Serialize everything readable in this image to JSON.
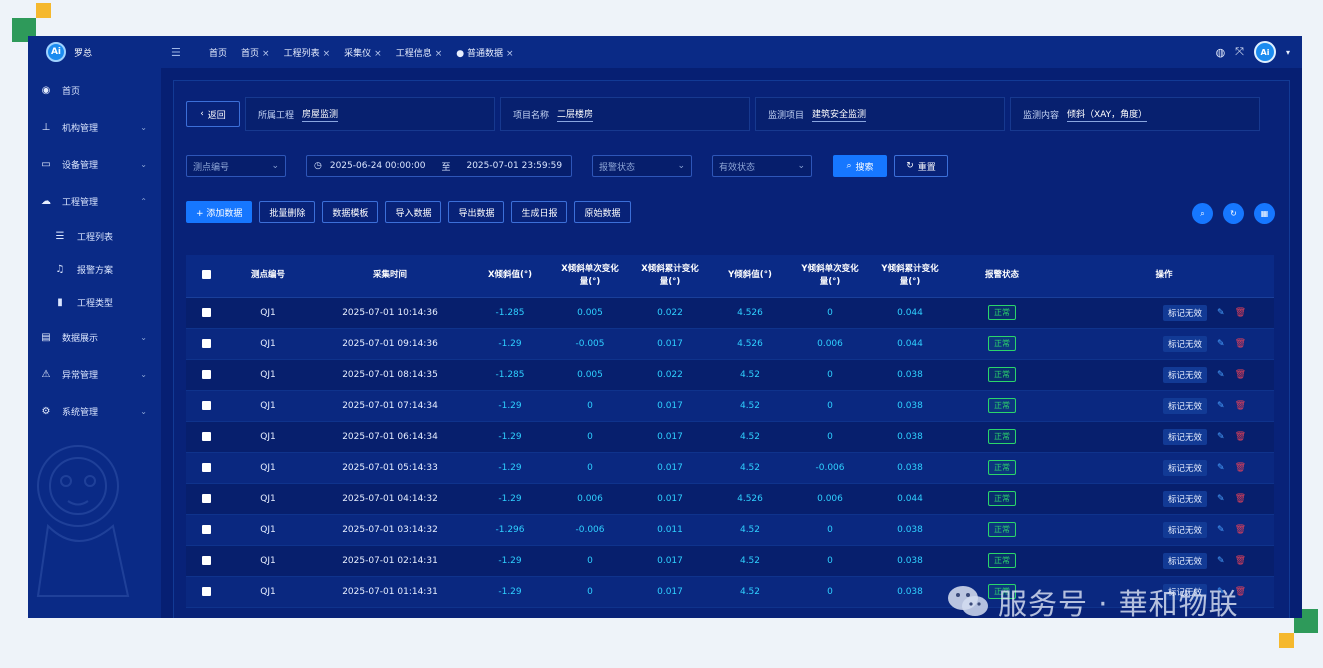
{
  "app": {
    "brand_name": "罗总",
    "avatar_text": "Ai"
  },
  "sidebar": {
    "items": [
      {
        "label": "首页",
        "icon": "dashboard-icon",
        "chevron": ""
      },
      {
        "label": "机构管理",
        "icon": "org-icon",
        "chevron": "⌄"
      },
      {
        "label": "设备管理",
        "icon": "monitor-icon",
        "chevron": "⌄"
      },
      {
        "label": "工程管理",
        "icon": "cloud-icon",
        "chevron": "⌃"
      }
    ],
    "sub_items": [
      {
        "label": "工程列表",
        "icon": "list-icon"
      },
      {
        "label": "报警方案",
        "icon": "alarm-icon"
      },
      {
        "label": "工程类型",
        "icon": "bar-icon"
      }
    ],
    "items_after": [
      {
        "label": "数据展示",
        "icon": "display-icon",
        "chevron": "⌄"
      },
      {
        "label": "异常管理",
        "icon": "warning-icon",
        "chevron": "⌄"
      },
      {
        "label": "系统管理",
        "icon": "gear-icon",
        "chevron": "⌄"
      }
    ]
  },
  "topbar": {
    "tabs": [
      {
        "label": "首页",
        "closable": ""
      },
      {
        "label": "首页",
        "closable": "×"
      },
      {
        "label": "工程列表",
        "closable": "×"
      },
      {
        "label": "采集仪",
        "closable": "×"
      },
      {
        "label": "工程信息",
        "closable": "×"
      },
      {
        "label": "● 普通数据",
        "closable": "×"
      }
    ]
  },
  "info": {
    "back_label": "返回",
    "project_key": "所属工程",
    "project_val": "房屋监测",
    "name_key": "项目名称",
    "name_val": "二层楼房",
    "item_key": "监测项目",
    "item_val": "建筑安全监测",
    "content_key": "监测内容",
    "content_val": "倾斜（XAY，角度）"
  },
  "filters": {
    "point_placeholder": "测点编号",
    "start_date": "2025-06-24 00:00:00",
    "to": "至",
    "end_date": "2025-07-01 23:59:59",
    "alarm_placeholder": "报警状态",
    "valid_placeholder": "有效状态",
    "search_label": "搜索",
    "reset_label": "重置"
  },
  "actions": {
    "add": "+ 添加数据",
    "batch_delete": "批量删除",
    "template": "数据模板",
    "import": "导入数据",
    "export": "导出数据",
    "report": "生成日报",
    "raw": "原始数据"
  },
  "table": {
    "headers": {
      "point": "测点编号",
      "time": "采集时间",
      "x_tilt": "X倾斜值(°)",
      "x_single_1": "X倾斜单次变化",
      "x_single_2": "量(°)",
      "x_total_1": "X倾斜累计变化",
      "x_total_2": "量(°)",
      "y_tilt": "Y倾斜值(°)",
      "y_single_1": "Y倾斜单次变化",
      "y_single_2": "量(°)",
      "y_total_1": "Y倾斜累计变化",
      "y_total_2": "量(°)",
      "alarm": "报警状态",
      "ops": "操作"
    },
    "status_label": "正常",
    "mark_label": "标记无效",
    "rows": [
      {
        "point": "QJ1",
        "time": "2025-07-01 10:14:36",
        "x": "-1.285",
        "xs": "0.005",
        "xt": "0.022",
        "y": "4.526",
        "ys": "0",
        "yt": "0.044"
      },
      {
        "point": "QJ1",
        "time": "2025-07-01 09:14:36",
        "x": "-1.29",
        "xs": "-0.005",
        "xt": "0.017",
        "y": "4.526",
        "ys": "0.006",
        "yt": "0.044"
      },
      {
        "point": "QJ1",
        "time": "2025-07-01 08:14:35",
        "x": "-1.285",
        "xs": "0.005",
        "xt": "0.022",
        "y": "4.52",
        "ys": "0",
        "yt": "0.038"
      },
      {
        "point": "QJ1",
        "time": "2025-07-01 07:14:34",
        "x": "-1.29",
        "xs": "0",
        "xt": "0.017",
        "y": "4.52",
        "ys": "0",
        "yt": "0.038"
      },
      {
        "point": "QJ1",
        "time": "2025-07-01 06:14:34",
        "x": "-1.29",
        "xs": "0",
        "xt": "0.017",
        "y": "4.52",
        "ys": "0",
        "yt": "0.038"
      },
      {
        "point": "QJ1",
        "time": "2025-07-01 05:14:33",
        "x": "-1.29",
        "xs": "0",
        "xt": "0.017",
        "y": "4.52",
        "ys": "-0.006",
        "yt": "0.038"
      },
      {
        "point": "QJ1",
        "time": "2025-07-01 04:14:32",
        "x": "-1.29",
        "xs": "0.006",
        "xt": "0.017",
        "y": "4.526",
        "ys": "0.006",
        "yt": "0.044"
      },
      {
        "point": "QJ1",
        "time": "2025-07-01 03:14:32",
        "x": "-1.296",
        "xs": "-0.006",
        "xt": "0.011",
        "y": "4.52",
        "ys": "0",
        "yt": "0.038"
      },
      {
        "point": "QJ1",
        "time": "2025-07-01 02:14:31",
        "x": "-1.29",
        "xs": "0",
        "xt": "0.017",
        "y": "4.52",
        "ys": "0",
        "yt": "0.038"
      },
      {
        "point": "QJ1",
        "time": "2025-07-01 01:14:31",
        "x": "-1.29",
        "xs": "0",
        "xt": "0.017",
        "y": "4.52",
        "ys": "0",
        "yt": "0.038"
      }
    ]
  },
  "watermark": {
    "text": "服务号 · 華和物联"
  }
}
